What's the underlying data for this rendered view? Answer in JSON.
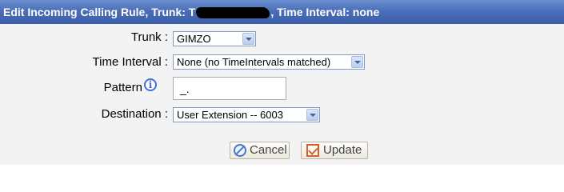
{
  "title": {
    "prefix": "Edit Incoming Calling Rule, Trunk: T",
    "suffix": ", Time Interval: none"
  },
  "form": {
    "trunk": {
      "label": "Trunk :",
      "value": "GIMZO"
    },
    "time_interval": {
      "label": "Time Interval :",
      "value": "None (no TimeIntervals matched)"
    },
    "pattern": {
      "label": "Pattern",
      "info_icon": "i",
      "value": "_."
    },
    "destination": {
      "label": "Destination :",
      "value": "User Extension -- 6003"
    }
  },
  "buttons": {
    "cancel": "Cancel",
    "update": "Update"
  },
  "icons": {
    "info": "info-icon",
    "cancel": "cancel-icon",
    "update": "checkbox-icon",
    "dropdown": "chevron-down-icon"
  },
  "colors": {
    "titlebar": "#4a6fb8",
    "background": "#f3f3f3",
    "info_icon": "#3d6fe0",
    "update_icon": "#d2612d"
  }
}
